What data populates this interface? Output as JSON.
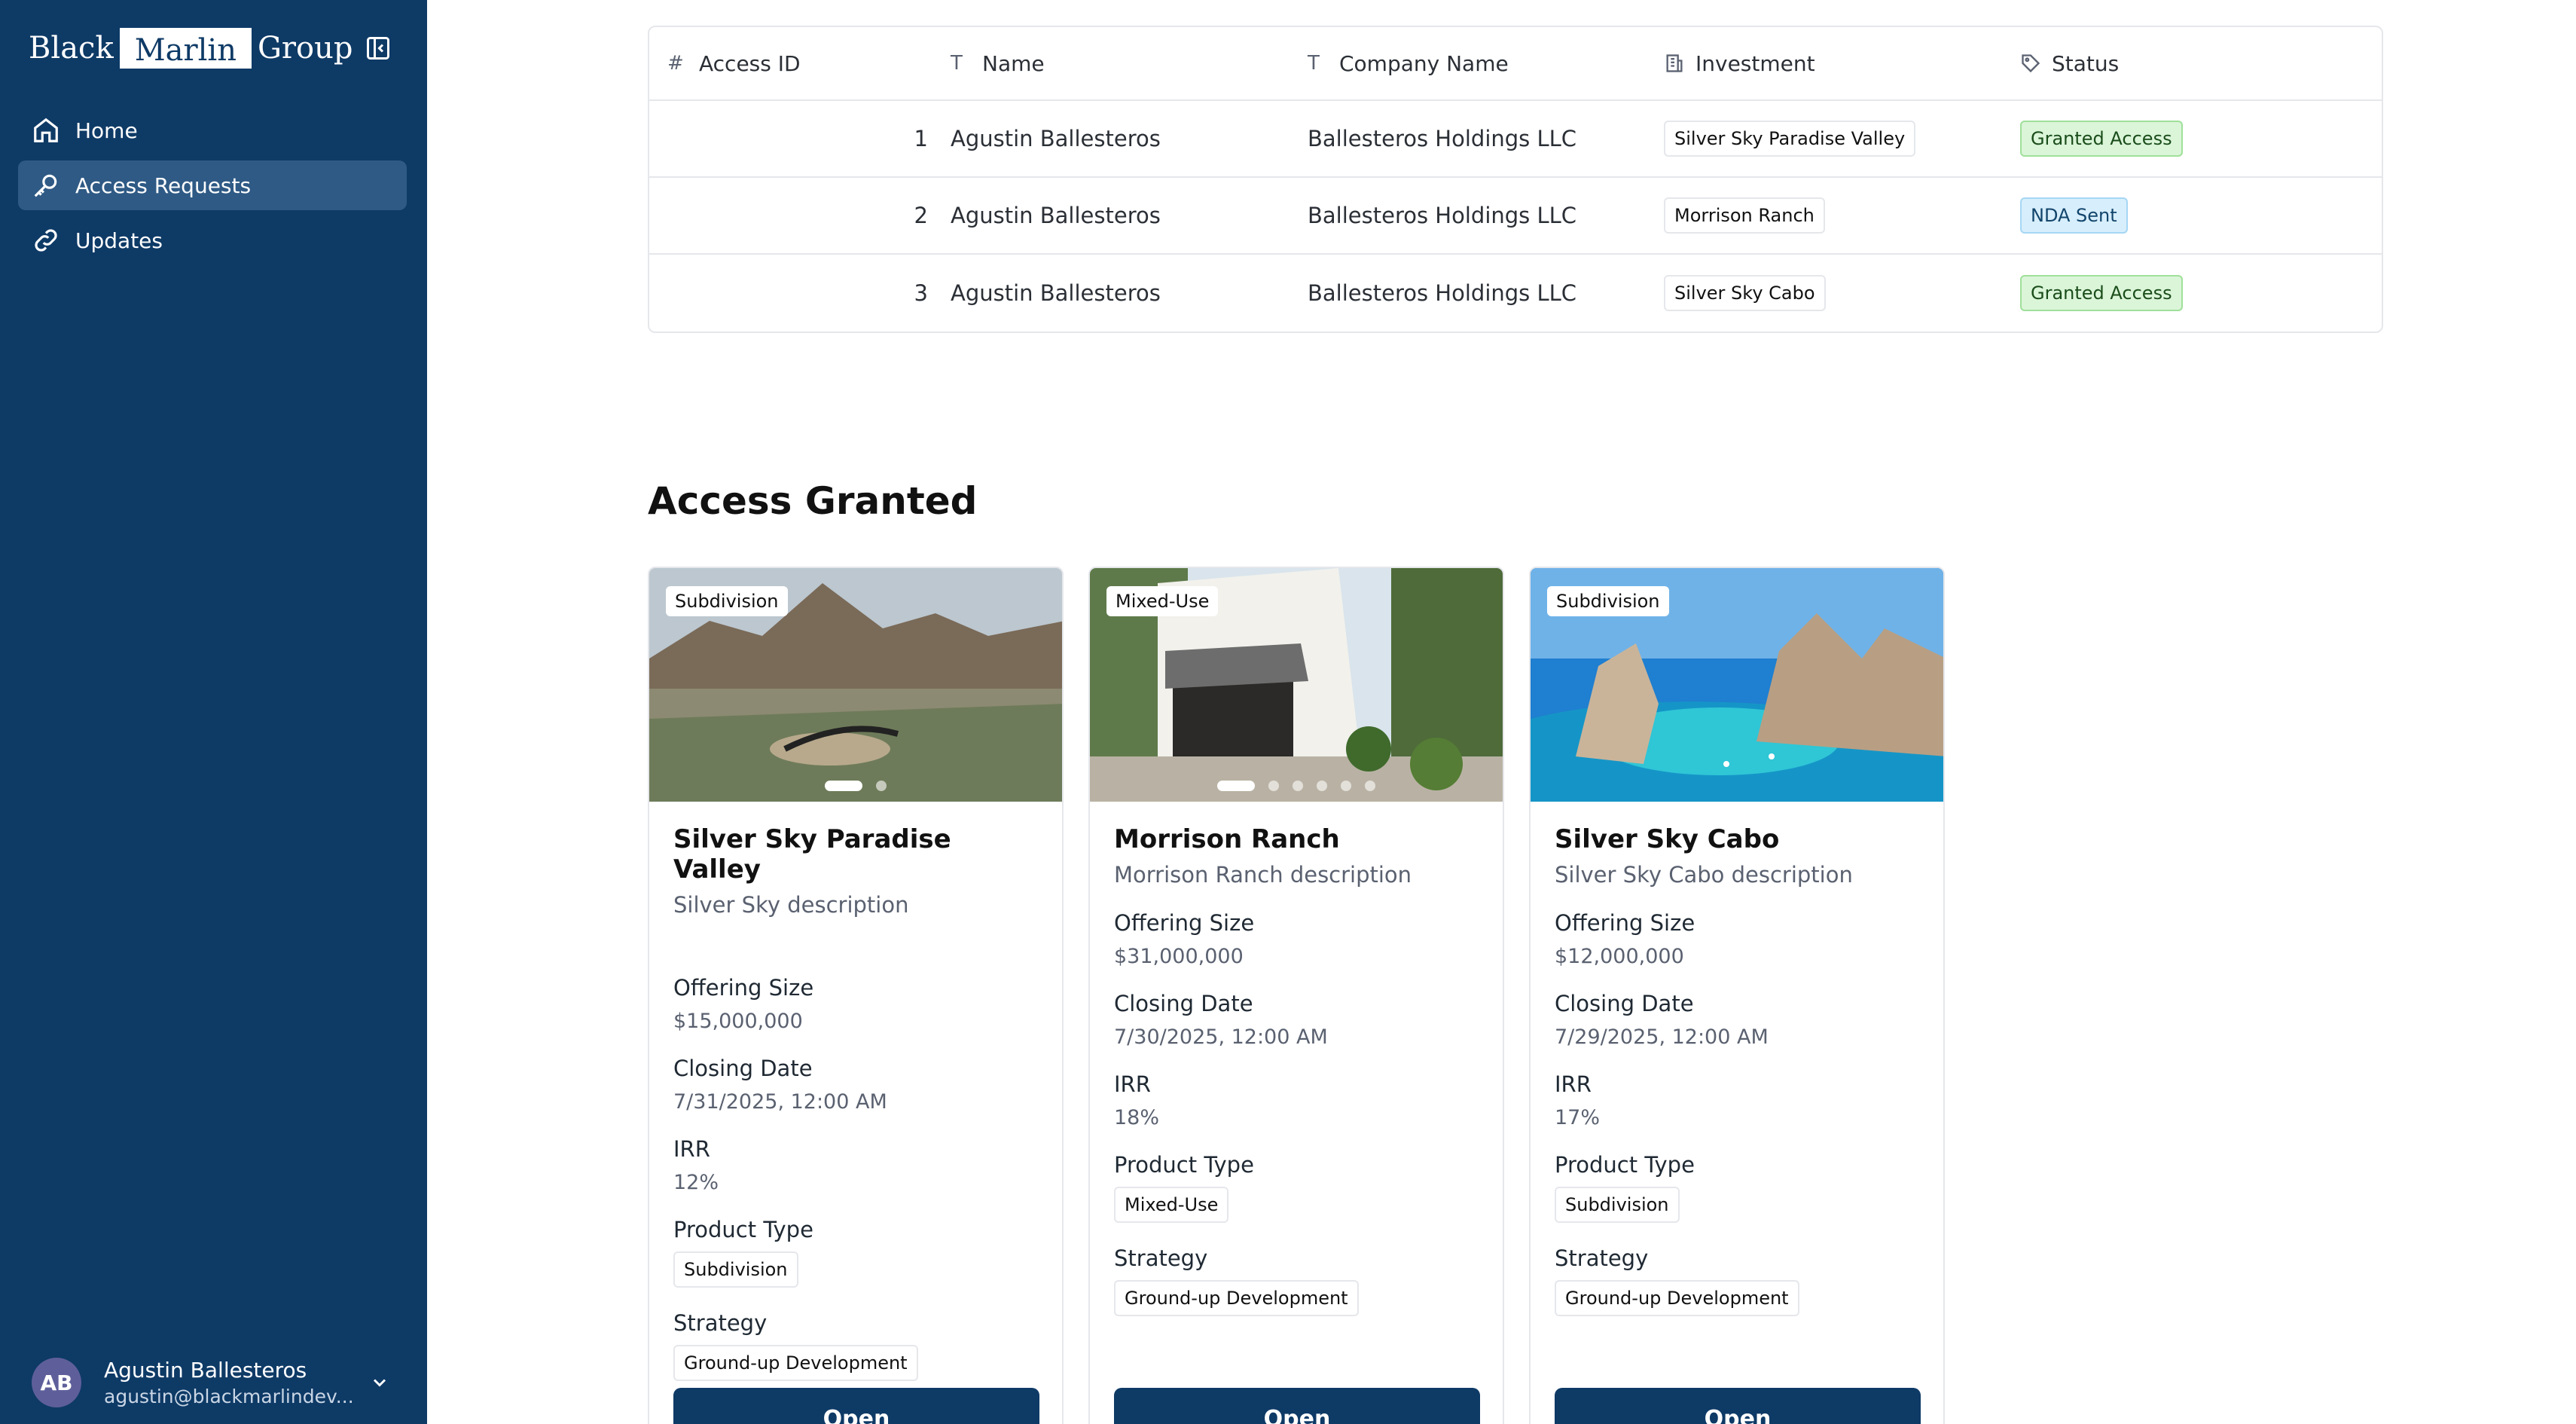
{
  "sidebar": {
    "logo": {
      "left": "Black",
      "box": "Marlin",
      "right": "Group"
    },
    "nav": [
      {
        "label": "Home",
        "icon": "home-icon"
      },
      {
        "label": "Access Requests",
        "icon": "key-icon"
      },
      {
        "label": "Updates",
        "icon": "link-icon"
      }
    ],
    "user": {
      "initials": "AB",
      "name": "Agustin Ballesteros",
      "email": "agustin@blackmarlindev..."
    }
  },
  "table": {
    "headers": {
      "id": "Access ID",
      "name": "Name",
      "company": "Company Name",
      "investment": "Investment",
      "status": "Status"
    },
    "rows": [
      {
        "id": "1",
        "name": "Agustin Ballesteros",
        "company": "Ballesteros Holdings LLC",
        "investment": "Silver Sky Paradise Valley",
        "status": "Granted Access"
      },
      {
        "id": "2",
        "name": "Agustin Ballesteros",
        "company": "Ballesteros Holdings LLC",
        "investment": "Morrison Ranch",
        "status": "NDA Sent"
      },
      {
        "id": "3",
        "name": "Agustin Ballesteros",
        "company": "Ballesteros Holdings LLC",
        "investment": "Silver Sky Cabo",
        "status": "Granted Access"
      }
    ]
  },
  "section": {
    "title": "Access Granted"
  },
  "cards": [
    {
      "badge": "Subdivision",
      "title": "Silver Sky Paradise Valley",
      "description": "Silver Sky description",
      "offering_label": "Offering Size",
      "offering": "$15,000,000",
      "closing_label": "Closing Date",
      "closing": "7/31/2025, 12:00 AM",
      "irr_label": "IRR",
      "irr": "12%",
      "product_label": "Product Type",
      "product": "Subdivision",
      "strategy_label": "Strategy",
      "strategy": "Ground-up Development",
      "button": "Open"
    },
    {
      "badge": "Mixed-Use",
      "title": "Morrison Ranch",
      "description": "Morrison Ranch description",
      "offering_label": "Offering Size",
      "offering": "$31,000,000",
      "closing_label": "Closing Date",
      "closing": "7/30/2025, 12:00 AM",
      "irr_label": "IRR",
      "irr": "18%",
      "product_label": "Product Type",
      "product": "Mixed-Use",
      "strategy_label": "Strategy",
      "strategy": "Ground-up Development",
      "button": "Open"
    },
    {
      "badge": "Subdivision",
      "title": "Silver Sky Cabo",
      "description": "Silver Sky Cabo description",
      "offering_label": "Offering Size",
      "offering": "$12,000,000",
      "closing_label": "Closing Date",
      "closing": "7/29/2025, 12:00 AM",
      "irr_label": "IRR",
      "irr": "17%",
      "product_label": "Product Type",
      "product": "Subdivision",
      "strategy_label": "Strategy",
      "strategy": "Ground-up Development",
      "button": "Open"
    }
  ],
  "colors": {
    "sidebar": "#0e3a66",
    "active_nav": "#2f5a85",
    "granted": "#dbf5d9",
    "nda": "#d7eefc"
  }
}
